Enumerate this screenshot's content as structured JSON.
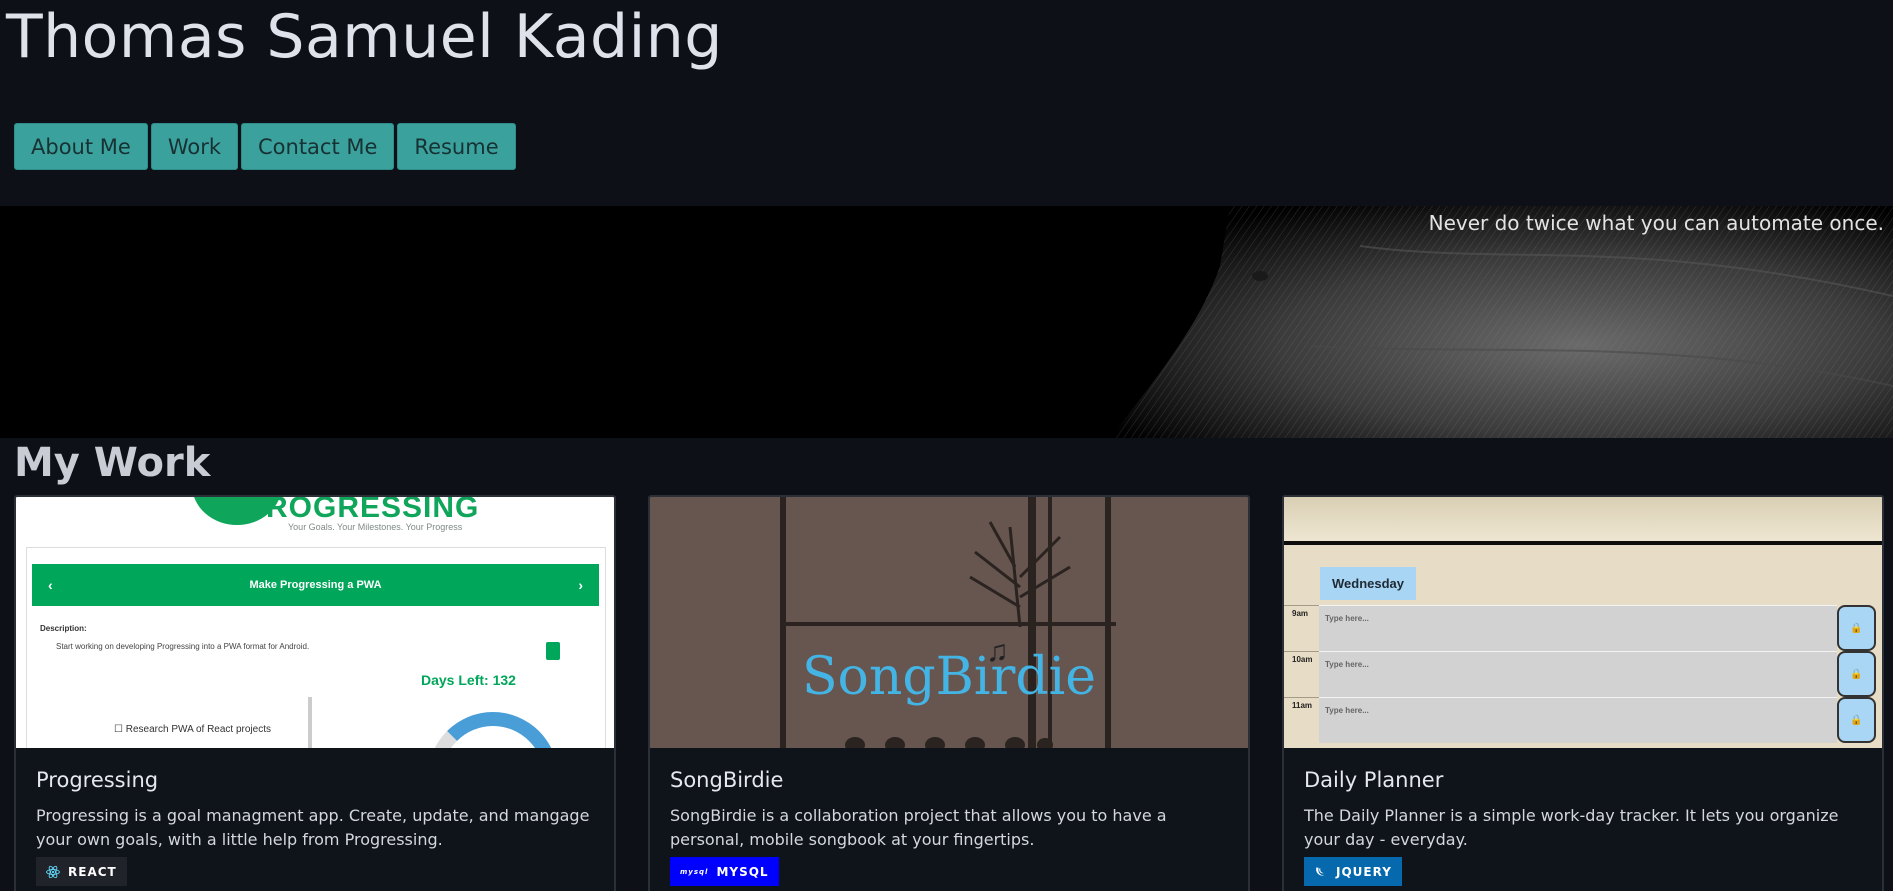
{
  "header": {
    "title": "Thomas Samuel Kading"
  },
  "nav": {
    "items": [
      "About Me",
      "Work",
      "Contact Me",
      "Resume"
    ]
  },
  "banner": {
    "tagline": "Never do twice what you can automate once."
  },
  "work": {
    "section_title": "My Work",
    "cards": [
      {
        "title": "Progressing",
        "description": "Progressing is a goal managment app. Create, update, and mangage your own goals, with a little help from Progressing.",
        "badge": "REACT",
        "screenshot": {
          "logo": "ROGRESSING",
          "logo_sub": "Your Goals. Your Milestones. Your Progress",
          "bar_title": "Make Progressing a PWA",
          "desc_label": "Description:",
          "desc_text": "Start working on developing Progressing into a PWA format for Android.",
          "days_left": "Days Left: 132",
          "checkbox_label": "Research PWA of React projects"
        }
      },
      {
        "title": "SongBirdie",
        "description": "SongBirdie is a collaboration project that allows you to have a personal, mobile songbook at your fingertips.",
        "badge": "MYSQL",
        "screenshot": {
          "logo": "SongBirdie"
        }
      },
      {
        "title": "Daily Planner",
        "description": "The Daily Planner is a simple work-day tracker. It lets you organize your day - everyday.",
        "badge": "JQUERY",
        "screenshot": {
          "day": "Wednesday",
          "rows": [
            {
              "hour": "9am",
              "placeholder": "Type here..."
            },
            {
              "hour": "10am",
              "placeholder": "Type here..."
            },
            {
              "hour": "11am",
              "placeholder": "Type here..."
            }
          ]
        }
      }
    ]
  },
  "colors": {
    "background": "#0d1017",
    "nav_button": "#3aa19d",
    "react_badge": "#20232a",
    "mysql_badge": "#0000ff",
    "jquery_badge": "#0769ad"
  }
}
